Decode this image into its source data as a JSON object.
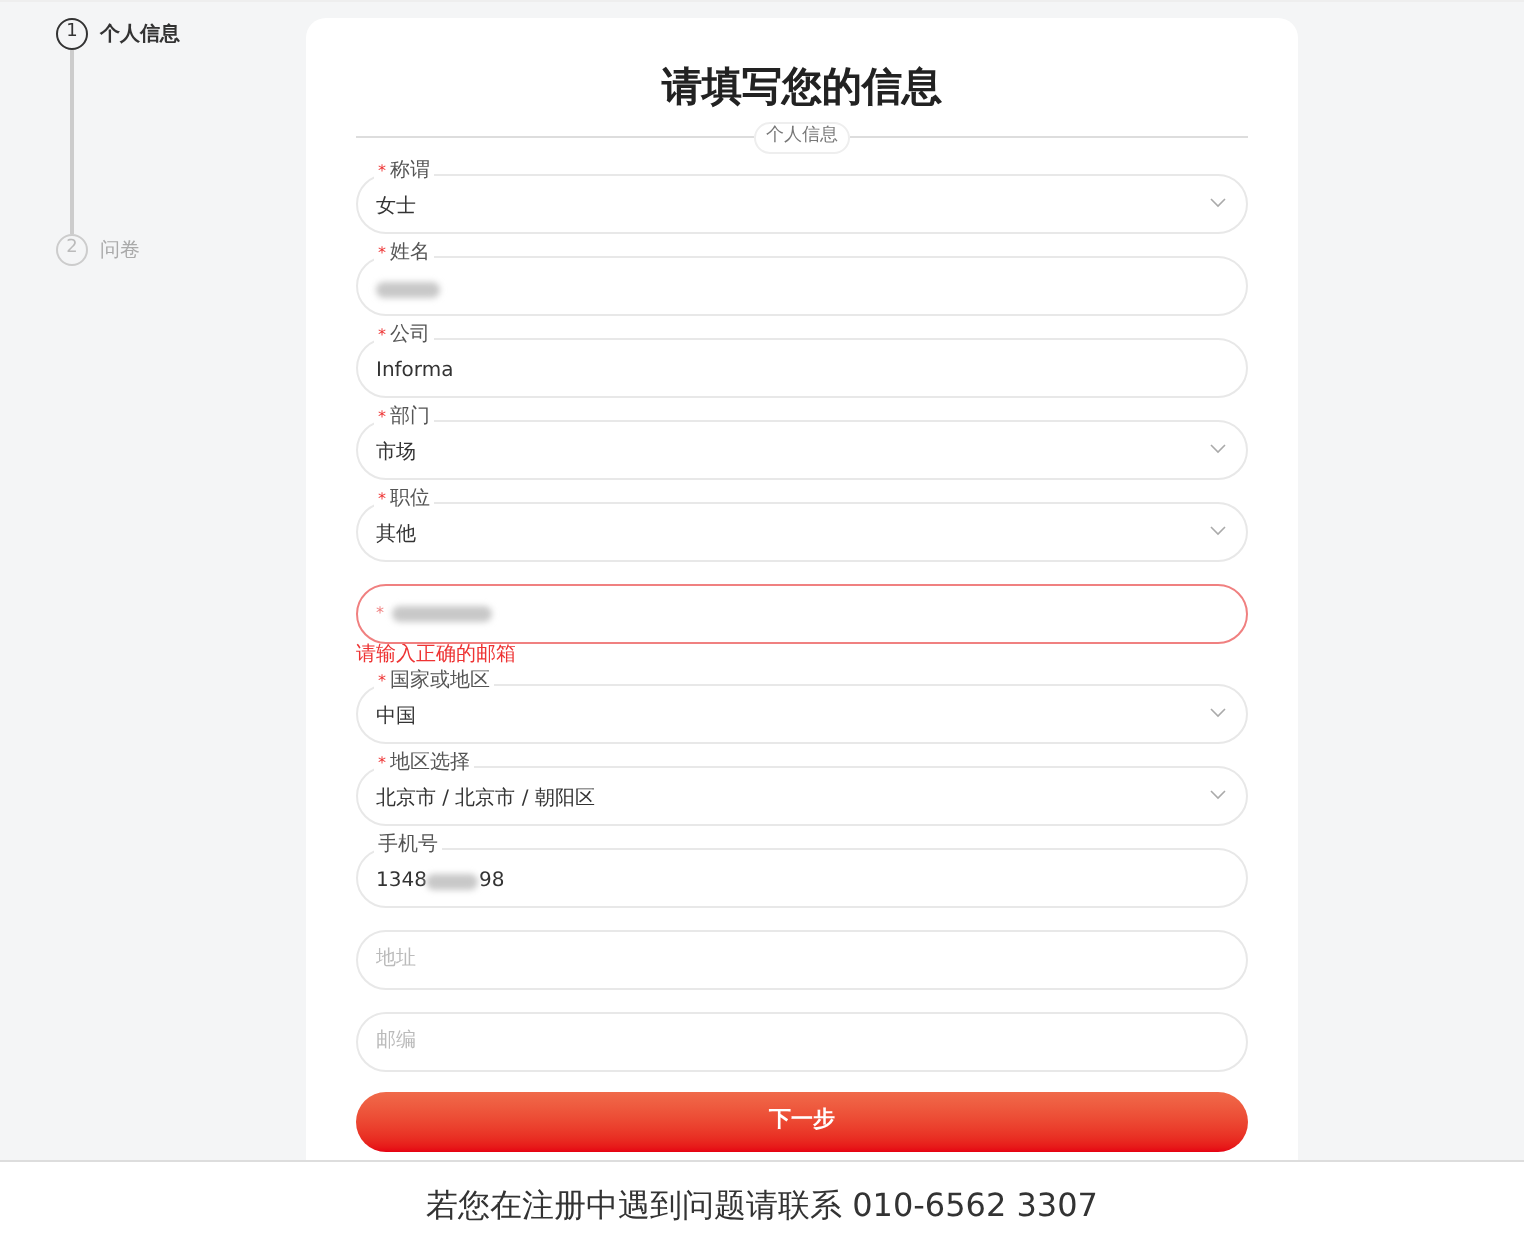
{
  "steps": [
    {
      "number": "1",
      "label": "个人信息",
      "selected": true
    },
    {
      "number": "2",
      "label": "问卷",
      "selected": false
    }
  ],
  "title": "请填写您的信息",
  "section": "个人信息",
  "fields": [
    {
      "kind": "select",
      "required_mark": "*",
      "label": "称谓",
      "value": "女士"
    },
    {
      "kind": "input",
      "required_mark": "*",
      "label": "姓名",
      "redacted": true
    },
    {
      "kind": "input",
      "required_mark": "*",
      "label": "公司",
      "value": "Informa"
    },
    {
      "kind": "select",
      "required_mark": "*",
      "label": "部门",
      "value": "市场"
    },
    {
      "kind": "select",
      "required_mark": "*",
      "label": "职位",
      "value": "其他"
    },
    {
      "kind": "input",
      "required_mark": "*",
      "redacted": true,
      "error": "请输入正确的邮箱"
    },
    {
      "kind": "select",
      "required_mark": "*",
      "label": "国家或地区",
      "value": "中国"
    },
    {
      "kind": "select",
      "required_mark": "*",
      "label": "地区选择",
      "value": "北京市 / 北京市 / 朝阳区"
    },
    {
      "kind": "input",
      "label": "手机号",
      "value": "1348",
      "value_end": "98",
      "redacted": true
    },
    {
      "kind": "input",
      "placeholder": "地址"
    },
    {
      "kind": "input",
      "placeholder": "邮编"
    }
  ],
  "next_button": "下一步",
  "footer": "若您在注册中遇到问题请联系 010-6562 3307"
}
